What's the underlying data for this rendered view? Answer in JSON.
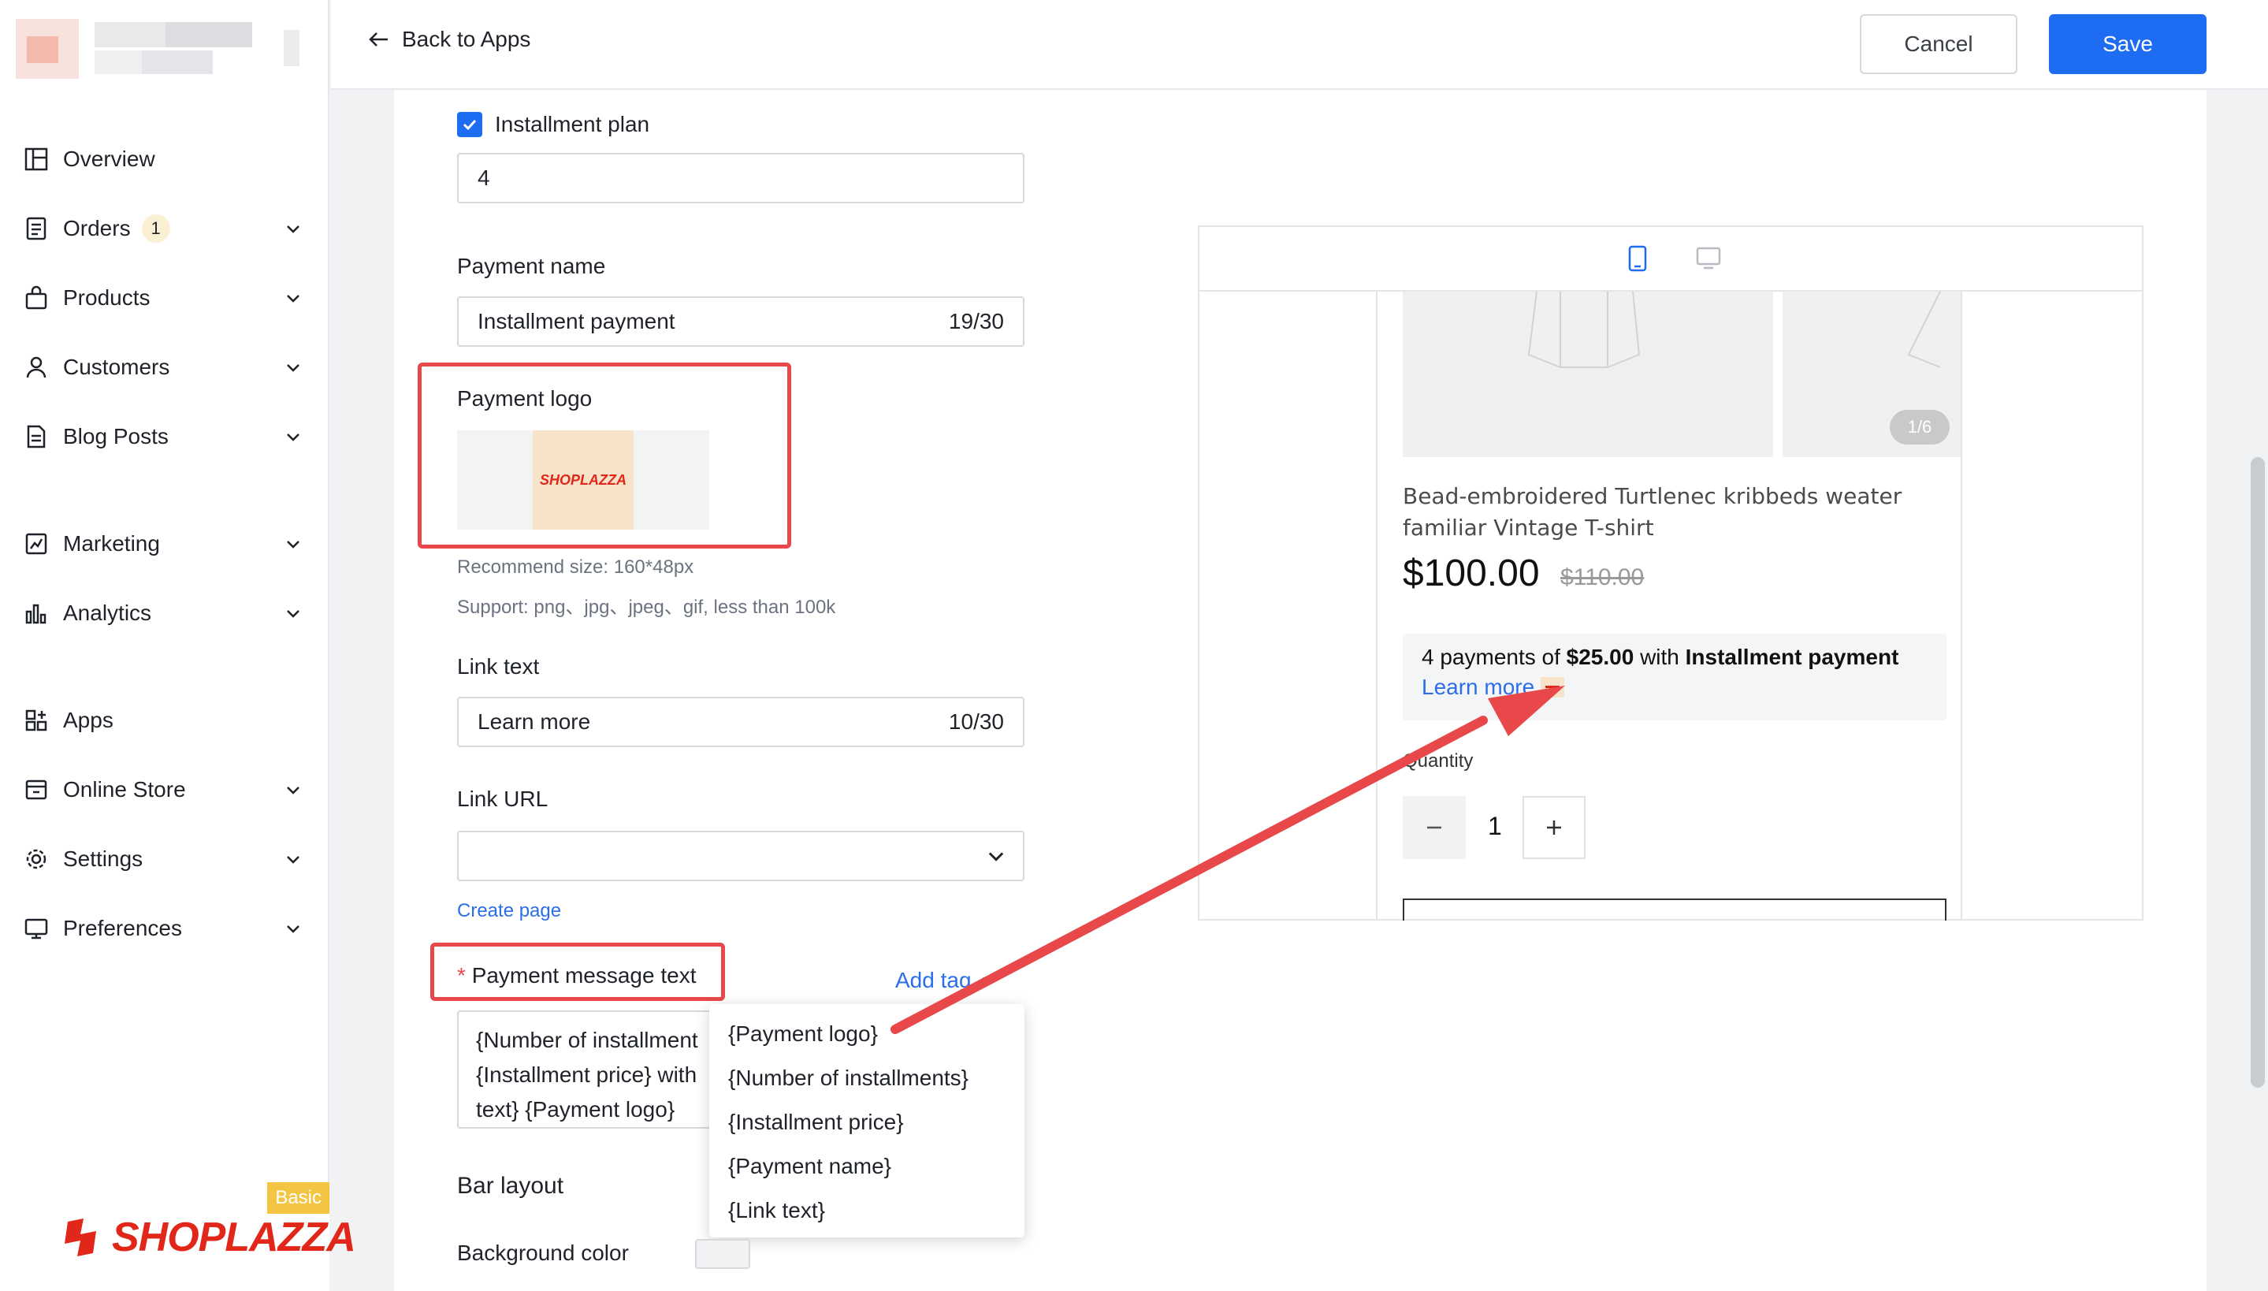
{
  "nav": {
    "items": [
      {
        "label": "Overview",
        "icon": "overview-icon"
      },
      {
        "label": "Orders",
        "icon": "orders-icon",
        "badge": "1"
      },
      {
        "label": "Products",
        "icon": "products-icon"
      },
      {
        "label": "Customers",
        "icon": "customers-icon"
      },
      {
        "label": "Blog Posts",
        "icon": "blog-posts-icon"
      },
      {
        "label": "Marketing",
        "icon": "marketing-icon"
      },
      {
        "label": "Analytics",
        "icon": "analytics-icon"
      },
      {
        "label": "Apps",
        "icon": "apps-icon"
      },
      {
        "label": "Online Store",
        "icon": "online-store-icon"
      },
      {
        "label": "Settings",
        "icon": "settings-icon"
      },
      {
        "label": "Preferences",
        "icon": "preferences-icon"
      }
    ]
  },
  "brand": {
    "name": "SHOPLAZZA",
    "plan_badge": "Basic"
  },
  "header": {
    "back_label": "Back to Apps",
    "cancel_label": "Cancel",
    "save_label": "Save"
  },
  "form": {
    "installment_plan_label": "Installment plan",
    "installment_plan_checked": true,
    "installment_plan_value": "4",
    "payment_name_label": "Payment name",
    "payment_name_value": "Installment payment",
    "payment_name_count": "19/30",
    "payment_logo_label": "Payment logo",
    "payment_logo_text": "SHOPLAZZA",
    "recommend_size": "Recommend size: 160*48px",
    "support_formats": "Support: png、jpg、jpeg、gif, less than 100k",
    "link_text_label": "Link text",
    "link_text_value": "Learn more",
    "link_text_count": "10/30",
    "link_url_label": "Link URL",
    "link_url_value": "",
    "create_page_label": "Create page",
    "message_required_mark": "*",
    "message_label": "Payment message text",
    "add_tag_label": "Add tag",
    "message_lines": [
      "{Number of installment",
      "{Installment price} with",
      "text} {Payment logo}"
    ],
    "bar_layout_label": "Bar layout",
    "background_color_label": "Background color"
  },
  "tag_dropdown": {
    "options": [
      "{Payment logo}",
      "{Number of installments}",
      "{Installment price}",
      "{Payment name}",
      "{Link text}"
    ]
  },
  "preview": {
    "image_counter": "1/6",
    "product_title": "Bead-embroidered Turtlenec kribbeds weater familiar Vintage T-shirt",
    "price": "$100.00",
    "compare_price": "$110.00",
    "installment_prefix": "4 payments of ",
    "installment_amount": "$25.00",
    "installment_mid": " with ",
    "installment_name": "Installment payment",
    "learn_more": "Learn more",
    "quantity_label": "Quantity",
    "quantity_value": "1"
  },
  "colors": {
    "accent": "#1d6cf2",
    "highlight": "#e8484a",
    "brand": "#e0271a"
  }
}
